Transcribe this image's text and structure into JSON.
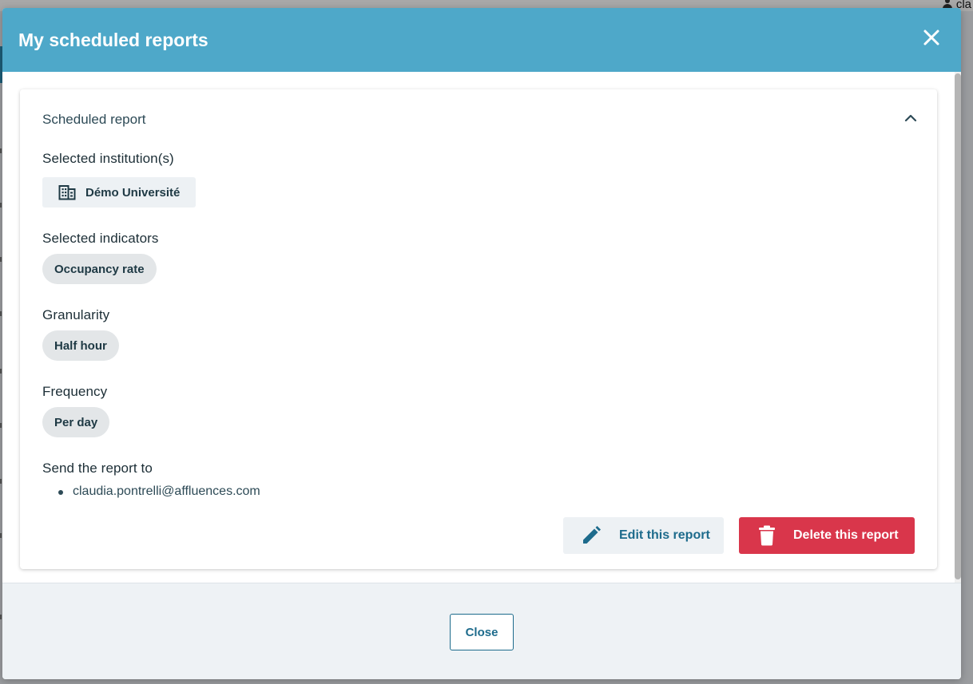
{
  "background": {
    "user_label": "cla"
  },
  "modal": {
    "title": "My scheduled reports",
    "close_icon": "close-icon",
    "card": {
      "title": "Scheduled report",
      "collapse_icon": "chevron-up-icon",
      "institutions": {
        "label": "Selected institution(s)",
        "items": [
          "Démo Université"
        ],
        "icon": "building-icon"
      },
      "indicators": {
        "label": "Selected indicators",
        "items": [
          "Occupancy rate"
        ]
      },
      "granularity": {
        "label": "Granularity",
        "value": "Half hour"
      },
      "frequency": {
        "label": "Frequency",
        "value": "Per day"
      },
      "recipients": {
        "label": "Send the report to",
        "items": [
          "claudia.pontrelli@affluences.com"
        ]
      },
      "actions": {
        "edit_label": "Edit this report",
        "edit_icon": "pencil-icon",
        "delete_label": "Delete this report",
        "delete_icon": "trash-icon"
      }
    },
    "footer": {
      "close_label": "Close"
    }
  },
  "colors": {
    "header": "#4ea8c9",
    "primary_text": "#1d6b8c",
    "danger": "#d9364b"
  }
}
